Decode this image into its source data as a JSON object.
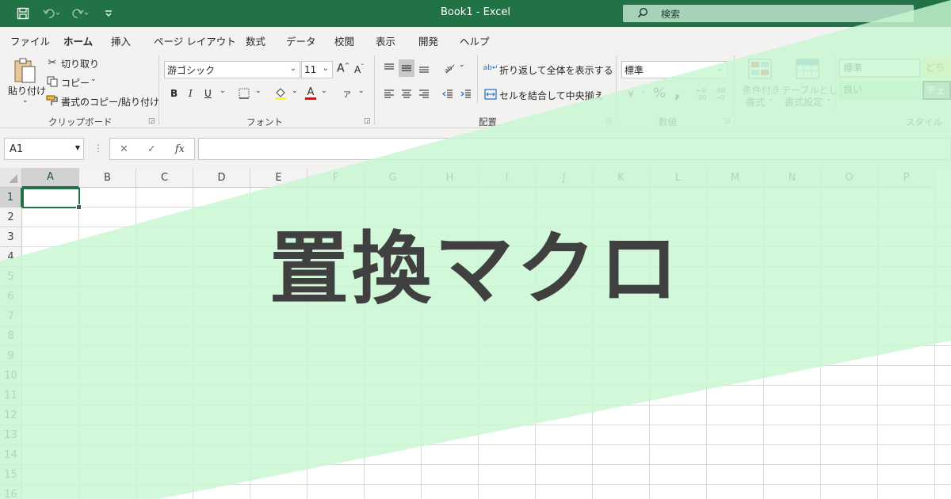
{
  "titlebar": {
    "title": "Book1  -  Excel",
    "search_label": "検索",
    "icons": [
      "save-icon",
      "undo-icon",
      "redo-icon",
      "customize-qat-icon"
    ]
  },
  "tabs": [
    "ファイル",
    "ホーム",
    "挿入",
    "ページ レイアウト",
    "数式",
    "データ",
    "校閲",
    "表示",
    "開発",
    "ヘルプ"
  ],
  "ribbon": {
    "clipboard": {
      "paste": "貼り付け",
      "cut": "切り取り",
      "copy": "コピー",
      "format_painter": "書式のコピー/貼り付け",
      "label": "クリップボード"
    },
    "font": {
      "name": "游ゴシック",
      "size": "11",
      "grow": "A",
      "shrink": "A",
      "bold": "B",
      "italic": "I",
      "underline": "U",
      "font_color_letter": "A",
      "label": "フォント"
    },
    "alignment": {
      "wrap": "折り返して全体を表示する",
      "merge": "セルを結合して中央揃え",
      "label": "配置"
    },
    "number": {
      "format": "標準",
      "percent": "%",
      "comma": ",",
      "label": "数値"
    },
    "styles": {
      "conditional_line1": "条件付き",
      "conditional_line2": "書式",
      "table_line1": "テーブルとして",
      "table_line2": "書式設定",
      "style_normal": "標準",
      "style_neutral": "どち",
      "style_good": "良い",
      "style_check": "チェ",
      "label": "スタイル"
    }
  },
  "formula_bar": {
    "name_box": "A1",
    "fx": "fx",
    "value": ""
  },
  "grid": {
    "columns": [
      "A",
      "B",
      "C",
      "D",
      "E",
      "F",
      "G",
      "H",
      "I",
      "J",
      "K",
      "L",
      "M",
      "N",
      "O",
      "P"
    ],
    "rows": [
      "1",
      "2",
      "3",
      "4",
      "5",
      "6",
      "7",
      "8",
      "9",
      "10",
      "11",
      "12",
      "13",
      "14",
      "15",
      "16"
    ],
    "selected_cell": "A1"
  },
  "overlay": {
    "headline": "置換マクロ",
    "accent_color": "#c8f7d2"
  },
  "colors": {
    "brand": "#217346",
    "ribbon_bg": "#f3f2f1"
  }
}
